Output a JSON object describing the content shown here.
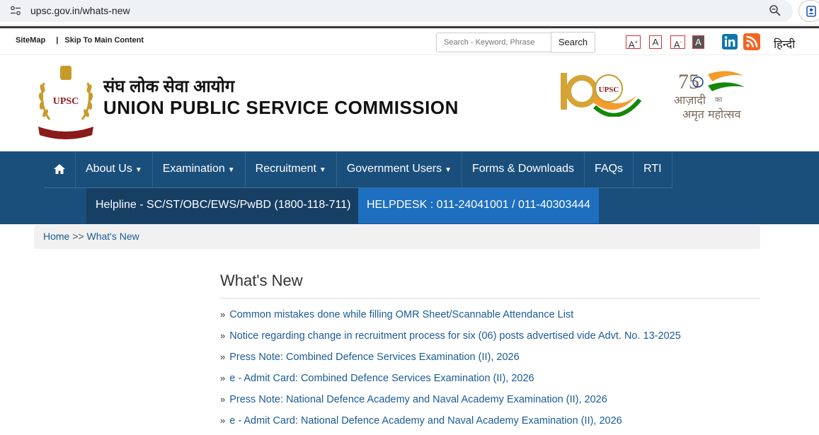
{
  "browser": {
    "url": "upsc.gov.in/whats-new"
  },
  "topbar": {
    "sitemap": "SiteMap",
    "separator": "|",
    "skip": "Skip To Main Content",
    "search_placeholder": "Search - Keyword, Phrase",
    "search_button": "Search",
    "font_increase": "A",
    "font_increase_sup": "+",
    "font_normal": "A",
    "font_decrease": "A",
    "font_decrease_sup": "-",
    "font_contrast": "A",
    "language": "हिन्दी",
    "linkedin_color": "#0e76a8",
    "rss_color": "#f26522"
  },
  "header": {
    "hindi_title": "संघ लोक सेवा आयोग",
    "english_title": "UNION PUBLIC SERVICE COMMISSION",
    "emblem_text": "UPSC",
    "logo100_text": "UPSC",
    "azadi_line1": "आज़ादी",
    "azadi_ka": "का",
    "azadi_line2": "अमृत महोत्सव",
    "azadi_number": "75"
  },
  "nav": {
    "items": [
      {
        "label": "About Us",
        "caret": true
      },
      {
        "label": "Examination",
        "caret": true
      },
      {
        "label": "Recruitment",
        "caret": true
      },
      {
        "label": "Government Users",
        "caret": true
      },
      {
        "label": "Forms & Downloads",
        "caret": false
      },
      {
        "label": "FAQs",
        "caret": false
      },
      {
        "label": "RTI",
        "caret": false
      }
    ],
    "helpline": "Helpline - SC/ST/OBC/EWS/PwBD (1800-118-711)",
    "helpdesk": "HELPDESK : 011-24041001 / 011-40303444",
    "bg_color": "#1a4f7c",
    "helpdesk_color": "#1e6fbf"
  },
  "breadcrumb": {
    "home": "Home",
    "sep": ">>",
    "current": "What's New"
  },
  "main": {
    "title": "What's New",
    "bullet": "»",
    "items": [
      "Common mistakes done while filling OMR Sheet/Scannable Attendance List",
      "Notice regarding change in recruitment process for six (06) posts advertised vide Advt. No. 13-2025",
      "Press Note: Combined Defence Services Examination (II), 2026",
      "e - Admit Card: Combined Defence Services Examination (II), 2026",
      "Press Note: National Defence Academy and Naval Academy Examination (II), 2026",
      "e - Admit Card: National Defence Academy and Naval Academy Examination (II), 2026"
    ]
  }
}
